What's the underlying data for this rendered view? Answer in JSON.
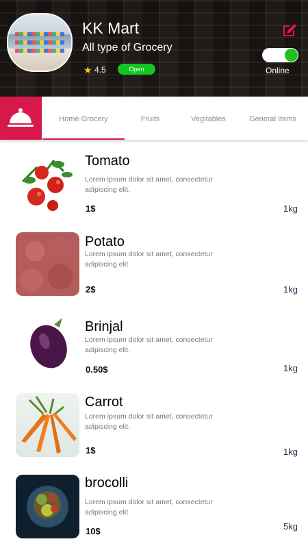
{
  "header": {
    "store_name": "KK Mart",
    "subtitle": "All type of Grocery",
    "rating": "4.5",
    "status_badge": "Open",
    "online_label": "Online",
    "online_toggle_on": true
  },
  "tabs": [
    {
      "label": "Home Grocery",
      "active": true
    },
    {
      "label": "Fruits",
      "active": false
    },
    {
      "label": "Vegitables",
      "active": false
    },
    {
      "label": "General Items",
      "active": false
    }
  ],
  "products": [
    {
      "name": "Tomato",
      "description": "Lorem ipsum dolor sit amet, consectetur adipiscing elit.",
      "price": "1$",
      "quantity": "1kg"
    },
    {
      "name": "Potato",
      "description": "Lorem ipsum dolor sit amet, consectetur adipiscing elit.",
      "price": "2$",
      "quantity": "1kg"
    },
    {
      "name": "Brinjal",
      "description": "Lorem ipsum dolor sit amet, consectetur adipiscing elit.",
      "price": "0.50$",
      "quantity": "1kg"
    },
    {
      "name": "Carrot",
      "description": "Lorem ipsum dolor sit amet, consectetur adipiscing elit.",
      "price": "1$",
      "quantity": "1kg"
    },
    {
      "name": "brocolli",
      "description": "Lorem ipsum dolor sit amet, consectetur adipiscing elit.",
      "price": "10$",
      "quantity": "5kg"
    }
  ],
  "colors": {
    "accent": "#d7184b",
    "open_badge": "#12c622",
    "toggle_on": "#1ec21e"
  },
  "icons": {
    "edit": "edit-icon",
    "star": "star-icon",
    "tab_menu": "food-cloche-icon"
  }
}
